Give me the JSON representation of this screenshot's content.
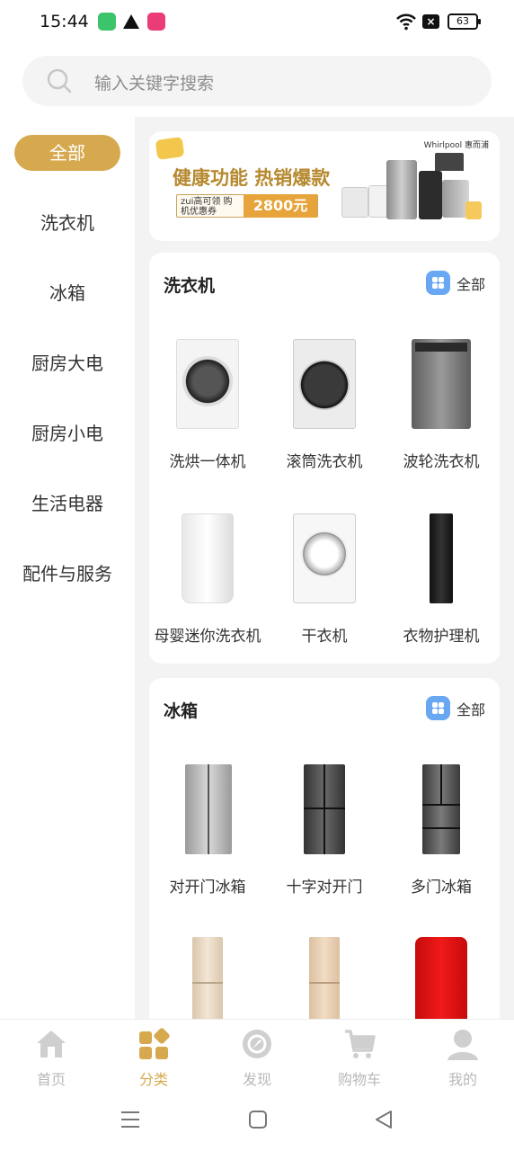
{
  "status_bar": {
    "time": "15:44",
    "battery": "63"
  },
  "search": {
    "placeholder": "输入关键字搜索"
  },
  "sidebar": {
    "items": [
      {
        "label": "全部",
        "active": true
      },
      {
        "label": "洗衣机",
        "active": false
      },
      {
        "label": "冰箱",
        "active": false
      },
      {
        "label": "厨房大电",
        "active": false
      },
      {
        "label": "厨房小电",
        "active": false
      },
      {
        "label": "生活电器",
        "active": false
      },
      {
        "label": "配件与服务",
        "active": false
      }
    ]
  },
  "banner": {
    "brand": "Whirlpool 惠而浦",
    "title": "健康功能 热销爆款",
    "coupon_text": "zui高可领 购机优惠券",
    "coupon_amount": "2800元"
  },
  "sections": [
    {
      "title": "洗衣机",
      "all_label": "全部",
      "items": [
        {
          "label": "洗烘一体机",
          "image": "front-load-washer-dryer"
        },
        {
          "label": "滚筒洗衣机",
          "image": "drum-washer"
        },
        {
          "label": "波轮洗衣机",
          "image": "top-load-washer"
        },
        {
          "label": "母婴迷你洗衣机",
          "image": "mini-washer"
        },
        {
          "label": "干衣机",
          "image": "dryer"
        },
        {
          "label": "衣物护理机",
          "image": "clothes-care-cabinet"
        }
      ]
    },
    {
      "title": "冰箱",
      "all_label": "全部",
      "items": [
        {
          "label": "对开门冰箱",
          "image": "side-by-side-fridge"
        },
        {
          "label": "十字对开门",
          "image": "cross-door-fridge"
        },
        {
          "label": "多门冰箱",
          "image": "multi-door-fridge"
        },
        {
          "label": "",
          "image": "three-door-fridge-champagne"
        },
        {
          "label": "",
          "image": "three-door-fridge-gold"
        },
        {
          "label": "",
          "image": "red-retro-fridge"
        }
      ]
    }
  ],
  "tabbar": {
    "tabs": [
      {
        "label": "首页",
        "icon": "home-icon",
        "active": false
      },
      {
        "label": "分类",
        "icon": "category-icon",
        "active": true
      },
      {
        "label": "发现",
        "icon": "discover-icon",
        "active": false
      },
      {
        "label": "购物车",
        "icon": "cart-icon",
        "active": false
      },
      {
        "label": "我的",
        "icon": "profile-icon",
        "active": false
      }
    ]
  },
  "colors": {
    "accent": "#d6a94e",
    "all_icon": "#6aa7f2",
    "content_bg": "#f3f3f3"
  }
}
